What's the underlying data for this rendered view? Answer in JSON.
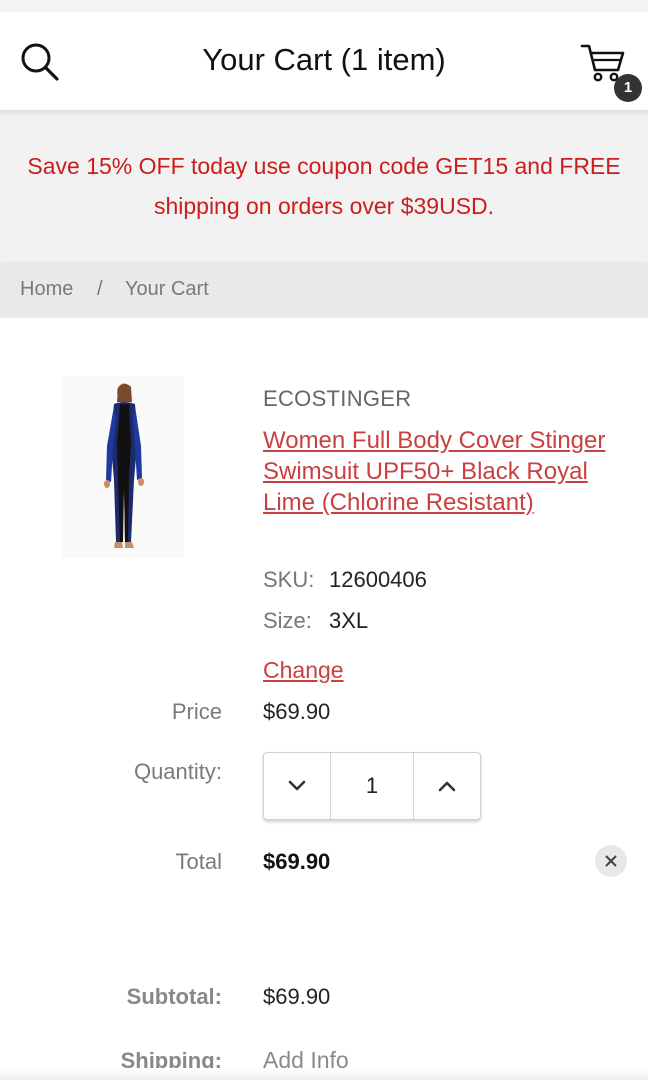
{
  "header": {
    "title": "Your Cart (1 item)",
    "cart_count": "1",
    "search_icon": "search-icon",
    "cart_icon": "cart-icon"
  },
  "promo": {
    "text": "Save 15% OFF today use coupon code GET15 and FREE shipping on orders over $39USD."
  },
  "breadcrumb": {
    "home": "Home",
    "separator": "/",
    "current": "Your Cart"
  },
  "item": {
    "brand": "ECOSTINGER",
    "title": "Women Full Body Cover Stinger Swimsuit UPF50+ Black Royal Lime (Chlorine Resistant)",
    "sku_label": "SKU:",
    "sku": "12600406",
    "size_label": "Size:",
    "size": "3XL",
    "change_label": "Change",
    "price_label": "Price",
    "price": "$69.90",
    "quantity_label": "Quantity:",
    "quantity": "1",
    "total_label": "Total",
    "total": "$69.90"
  },
  "summary": {
    "subtotal_label": "Subtotal:",
    "subtotal": "$69.90",
    "shipping_label": "Shipping:",
    "shipping_action": "Add Info"
  },
  "colors": {
    "accent_red": "#cc1d1d",
    "link_red": "#c94040",
    "badge": "#333333"
  }
}
